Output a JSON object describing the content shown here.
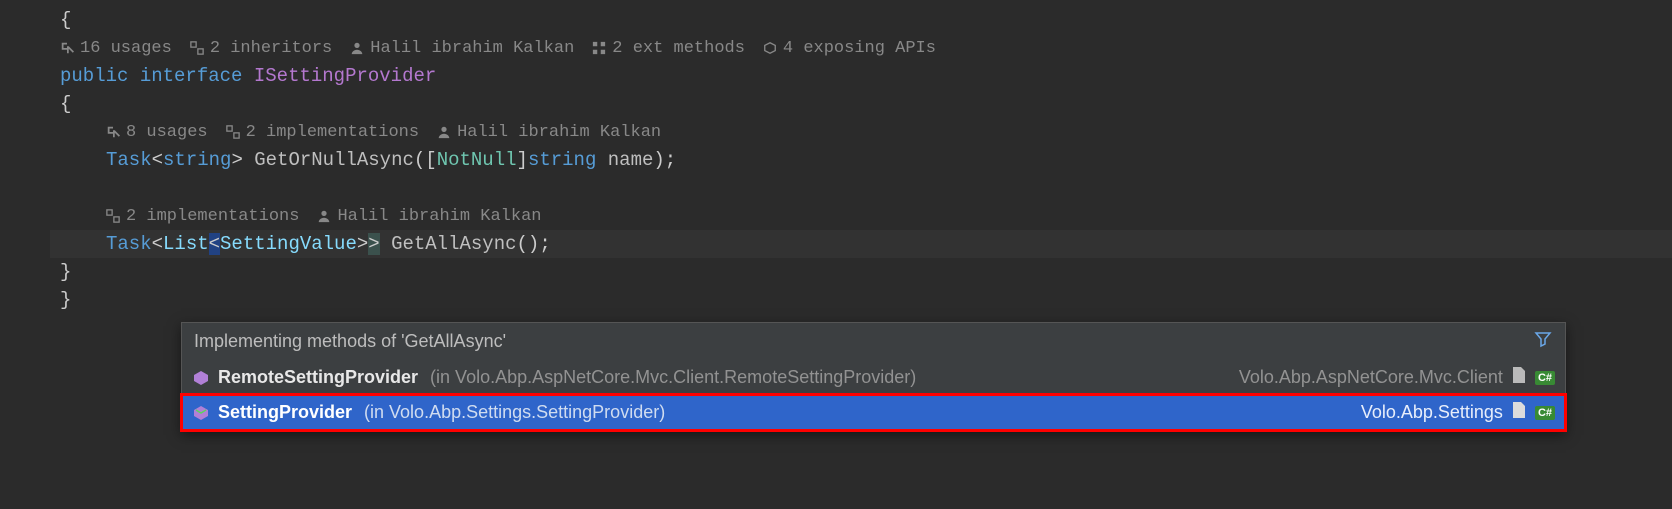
{
  "braces": {
    "open": "{",
    "close": "}",
    "top_open": "{",
    "top_close": "}"
  },
  "outer_hints": {
    "usages": "16 usages",
    "inheritors": "2 inheritors",
    "author": "Halil ibrahim Kalkan",
    "ext_methods": "2 ext methods",
    "exposing": "4 exposing APIs"
  },
  "decl": {
    "kw_public": "public",
    "kw_interface": "interface",
    "name": "ISettingProvider"
  },
  "method1_hints": {
    "usages": "8 usages",
    "impl": "2 implementations",
    "author": "Halil ibrahim Kalkan"
  },
  "method1": {
    "ret_type": "Task",
    "generic_open": "<",
    "generic_arg": "string",
    "generic_close": ">",
    "name": "GetOrNullAsync",
    "params_open": "(",
    "attr_open": "[",
    "attr": "NotNull",
    "attr_close": "]",
    "param_type": "string",
    "param_name": "name",
    "params_close": ")",
    "semi": ";"
  },
  "method2_hints": {
    "impl": "2 implementations",
    "author": "Halil ibrahim Kalkan"
  },
  "method2": {
    "ret_type": "Task",
    "generic_open": "<",
    "list_type": "List",
    "list_open": "<",
    "sv_type": "SettingValue",
    "list_close": ">",
    "generic_close": ">",
    "name": "GetAllAsync",
    "parens": "()",
    "semi": ";"
  },
  "popup": {
    "title": "Implementing methods of 'GetAllAsync'",
    "items": [
      {
        "name": "RemoteSettingProvider",
        "hint": "(in Volo.Abp.AspNetCore.Mvc.Client.RemoteSettingProvider)",
        "right": "Volo.Abp.AspNetCore.Mvc.Client",
        "badge": "C#"
      },
      {
        "name": "SettingProvider",
        "hint": "(in Volo.Abp.Settings.SettingProvider)",
        "right": "Volo.Abp.Settings",
        "badge": "C#"
      }
    ]
  }
}
